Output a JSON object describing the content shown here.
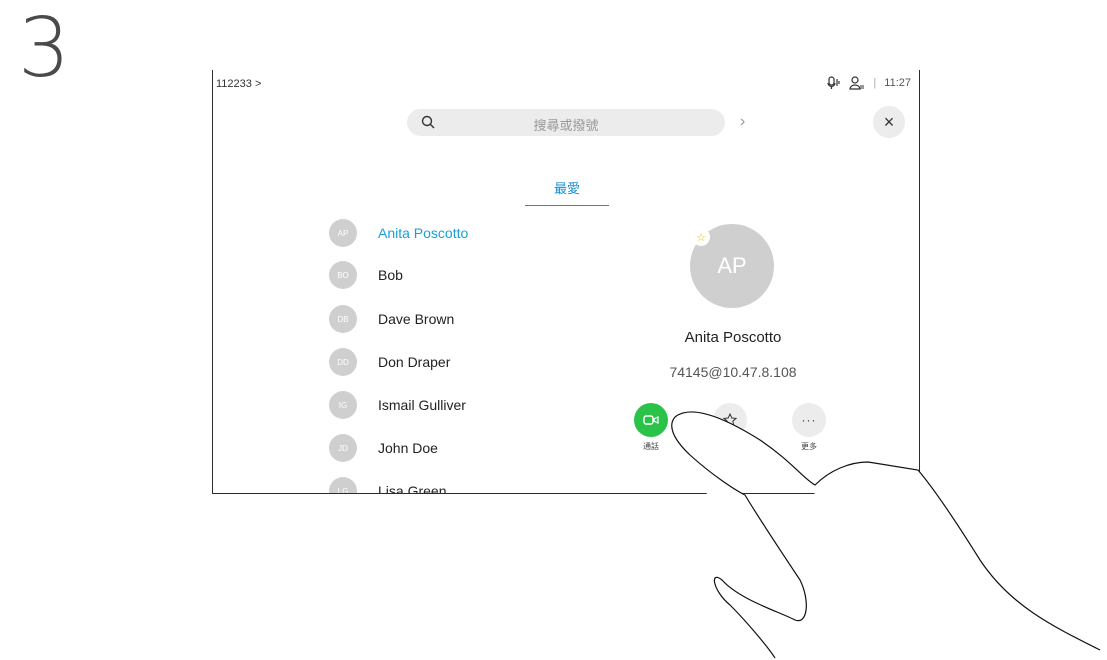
{
  "step_number": "3",
  "header": {
    "breadcrumb": "112233 >",
    "time": "11:27"
  },
  "search": {
    "placeholder": "搜尋或撥號"
  },
  "tabs": [
    {
      "label": "最愛"
    }
  ],
  "contacts": [
    {
      "initials": "AP",
      "name": "Anita Poscotto"
    },
    {
      "initials": "BO",
      "name": "Bob"
    },
    {
      "initials": "DB",
      "name": "Dave Brown"
    },
    {
      "initials": "DD",
      "name": "Don Draper"
    },
    {
      "initials": "IG",
      "name": "Ismail Gulliver"
    },
    {
      "initials": "JD",
      "name": "John Doe"
    },
    {
      "initials": "LG",
      "name": "Lisa Green"
    }
  ],
  "detail": {
    "initials": "AP",
    "name": "Anita Poscotto",
    "address": "74145@10.47.8.108",
    "actions": [
      {
        "label": "通話",
        "icon": "video-camera-icon"
      },
      {
        "label": "",
        "icon": "star-icon"
      },
      {
        "label": "更多",
        "icon": "more-icon"
      }
    ]
  },
  "colors": {
    "accent": "#1a8fd1",
    "call_green": "#2bc24a",
    "avatar_gray": "#cfcfcf"
  }
}
